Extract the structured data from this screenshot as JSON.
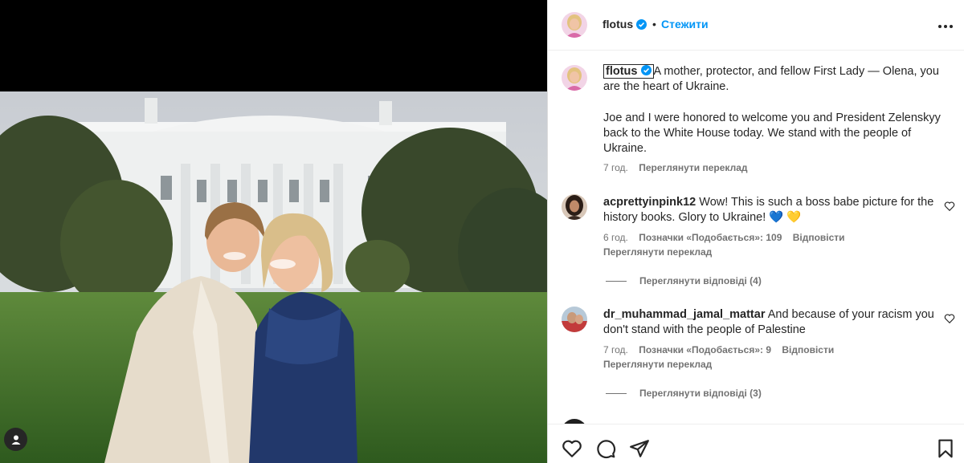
{
  "post": {
    "username": "flotus",
    "follow_label": "Стежити",
    "dot": "•",
    "more_label": "•••"
  },
  "caption": {
    "username": "flotus",
    "paragraph1": "A mother, protector, and fellow First Lady — Olena, you are the heart of Ukraine.",
    "paragraph2": "Joe and I were honored to welcome you and President Zelenskyy back to the White House today. We stand with the people of Ukraine.",
    "time": "7 год.",
    "translate_label": "Переглянути переклад"
  },
  "comments": [
    {
      "username": "acprettyinpink12",
      "text": "Wow! This is such a boss babe picture for the history books. Glory to Ukraine! 💙 💛",
      "time": "6 год.",
      "likes": "Позначки «Подобається»: 109",
      "reply_label": "Відповісти",
      "translate_label": "Переглянути переклад",
      "view_replies": "Переглянути відповіді (4)"
    },
    {
      "username": "dr_muhammad_jamal_mattar",
      "text": "And because of your racism you don't stand with the people of Palestine",
      "time": "7 год.",
      "likes": "Позначки «Подобається»: 9",
      "reply_label": "Відповісти",
      "translate_label": "Переглянути переклад",
      "view_replies": "Переглянути відповіді (3)"
    }
  ],
  "icons": {
    "verified": "verified-badge-icon",
    "like": "heart-icon",
    "comment": "comment-bubble-icon",
    "share": "send-icon",
    "save": "bookmark-icon",
    "tag": "user-tag-icon"
  },
  "colors": {
    "accent": "#0095f6",
    "text": "#262626",
    "secondary": "#737373"
  }
}
